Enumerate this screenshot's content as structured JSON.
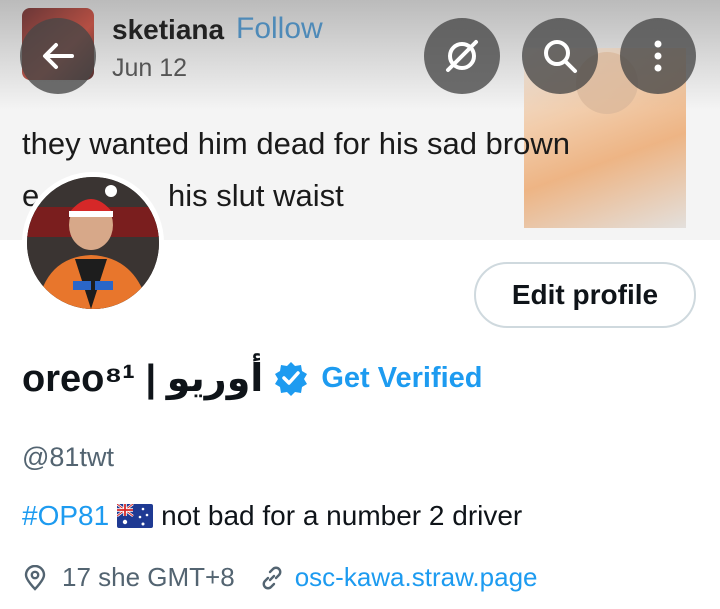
{
  "header_tweet": {
    "username": "sketiana",
    "follow_label": "Follow",
    "date": "Jun 12",
    "line1": "they wanted him dead for his sad brown",
    "line2_fragment": "e",
    "line2": "his slut waist"
  },
  "toolbar": {
    "back_icon": "arrow-left-icon",
    "grok_icon": "grok-icon",
    "search_icon": "search-icon",
    "more_icon": "more-vertical-icon"
  },
  "profile": {
    "edit_label": "Edit profile",
    "display_name": "oreo⁸¹ | أوريو",
    "get_verified": "Get Verified",
    "handle": "@81twt",
    "bio_hashtag": "#OP81",
    "bio_text": "not bad for a number 2 driver",
    "location": "17 she GMT+8",
    "website": "osc-kawa.straw.page"
  },
  "colors": {
    "accent": "#1d9bf0",
    "secondary_text": "#536471",
    "primary_text": "#0f1419"
  }
}
